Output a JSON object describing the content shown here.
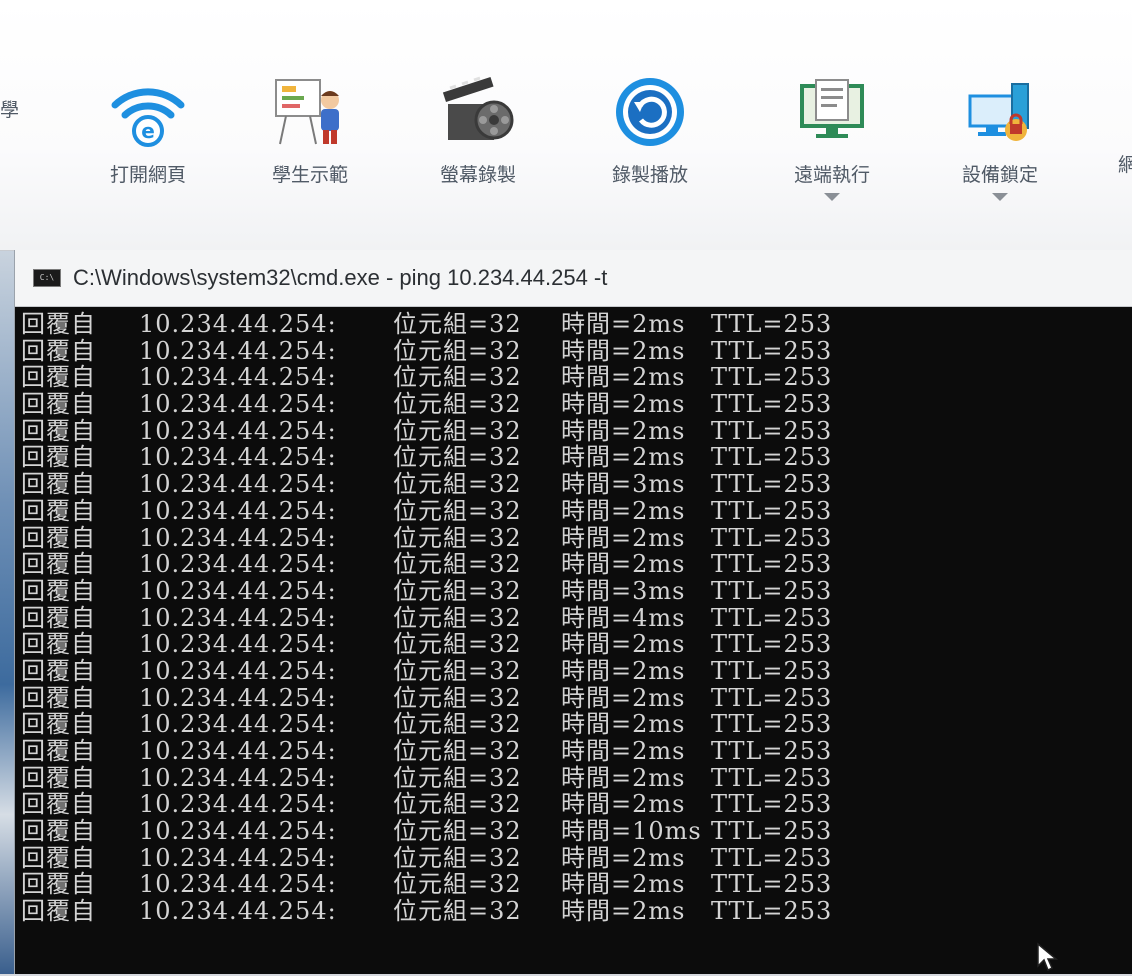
{
  "toolbar": {
    "edge_left_label": "學",
    "edge_right_label": "網",
    "items": [
      {
        "label": "打開網頁",
        "icon": "ie-wifi-icon",
        "has_dropdown": false
      },
      {
        "label": "學生示範",
        "icon": "student-demo-icon",
        "has_dropdown": false
      },
      {
        "label": "螢幕錄製",
        "icon": "film-clapper-icon",
        "has_dropdown": false
      },
      {
        "label": "錄製播放",
        "icon": "replay-circle-icon",
        "has_dropdown": false
      },
      {
        "label": "遠端執行",
        "icon": "remote-exec-icon",
        "has_dropdown": true
      },
      {
        "label": "設備鎖定",
        "icon": "device-lock-icon",
        "has_dropdown": true
      }
    ]
  },
  "cmd_window": {
    "title": "C:\\Windows\\system32\\cmd.exe - ping  10.234.44.254 -t",
    "app_icon_text": "C:\\",
    "lines": [
      {
        "prefix": "回覆自",
        "ip": "10.234.44.254:",
        "bytes": "位元組=32",
        "time": "時間=2ms",
        "ttl": "TTL=253"
      },
      {
        "prefix": "回覆自",
        "ip": "10.234.44.254:",
        "bytes": "位元組=32",
        "time": "時間=2ms",
        "ttl": "TTL=253"
      },
      {
        "prefix": "回覆自",
        "ip": "10.234.44.254:",
        "bytes": "位元組=32",
        "time": "時間=2ms",
        "ttl": "TTL=253"
      },
      {
        "prefix": "回覆自",
        "ip": "10.234.44.254:",
        "bytes": "位元組=32",
        "time": "時間=2ms",
        "ttl": "TTL=253"
      },
      {
        "prefix": "回覆自",
        "ip": "10.234.44.254:",
        "bytes": "位元組=32",
        "time": "時間=2ms",
        "ttl": "TTL=253"
      },
      {
        "prefix": "回覆自",
        "ip": "10.234.44.254:",
        "bytes": "位元組=32",
        "time": "時間=2ms",
        "ttl": "TTL=253"
      },
      {
        "prefix": "回覆自",
        "ip": "10.234.44.254:",
        "bytes": "位元組=32",
        "time": "時間=3ms",
        "ttl": "TTL=253"
      },
      {
        "prefix": "回覆自",
        "ip": "10.234.44.254:",
        "bytes": "位元組=32",
        "time": "時間=2ms",
        "ttl": "TTL=253"
      },
      {
        "prefix": "回覆自",
        "ip": "10.234.44.254:",
        "bytes": "位元組=32",
        "time": "時間=2ms",
        "ttl": "TTL=253"
      },
      {
        "prefix": "回覆自",
        "ip": "10.234.44.254:",
        "bytes": "位元組=32",
        "time": "時間=2ms",
        "ttl": "TTL=253"
      },
      {
        "prefix": "回覆自",
        "ip": "10.234.44.254:",
        "bytes": "位元組=32",
        "time": "時間=3ms",
        "ttl": "TTL=253"
      },
      {
        "prefix": "回覆自",
        "ip": "10.234.44.254:",
        "bytes": "位元組=32",
        "time": "時間=4ms",
        "ttl": "TTL=253"
      },
      {
        "prefix": "回覆自",
        "ip": "10.234.44.254:",
        "bytes": "位元組=32",
        "time": "時間=2ms",
        "ttl": "TTL=253"
      },
      {
        "prefix": "回覆自",
        "ip": "10.234.44.254:",
        "bytes": "位元組=32",
        "time": "時間=2ms",
        "ttl": "TTL=253"
      },
      {
        "prefix": "回覆自",
        "ip": "10.234.44.254:",
        "bytes": "位元組=32",
        "time": "時間=2ms",
        "ttl": "TTL=253"
      },
      {
        "prefix": "回覆自",
        "ip": "10.234.44.254:",
        "bytes": "位元組=32",
        "time": "時間=2ms",
        "ttl": "TTL=253"
      },
      {
        "prefix": "回覆自",
        "ip": "10.234.44.254:",
        "bytes": "位元組=32",
        "time": "時間=2ms",
        "ttl": "TTL=253"
      },
      {
        "prefix": "回覆自",
        "ip": "10.234.44.254:",
        "bytes": "位元組=32",
        "time": "時間=2ms",
        "ttl": "TTL=253"
      },
      {
        "prefix": "回覆自",
        "ip": "10.234.44.254:",
        "bytes": "位元組=32",
        "time": "時間=2ms",
        "ttl": "TTL=253"
      },
      {
        "prefix": "回覆自",
        "ip": "10.234.44.254:",
        "bytes": "位元組=32",
        "time": "時間=10ms",
        "ttl": "TTL=253"
      },
      {
        "prefix": "回覆自",
        "ip": "10.234.44.254:",
        "bytes": "位元組=32",
        "time": "時間=2ms",
        "ttl": "TTL=253"
      },
      {
        "prefix": "回覆自",
        "ip": "10.234.44.254:",
        "bytes": "位元組=32",
        "time": "時間=2ms",
        "ttl": "TTL=253"
      },
      {
        "prefix": "回覆自",
        "ip": "10.234.44.254:",
        "bytes": "位元組=32",
        "time": "時間=2ms",
        "ttl": "TTL=253"
      }
    ]
  },
  "colors": {
    "console_bg": "#0c0c0c",
    "console_text": "#d4d4d4",
    "ribbon_bg": "#ffffff",
    "accent_blue": "#1e8fe0"
  }
}
